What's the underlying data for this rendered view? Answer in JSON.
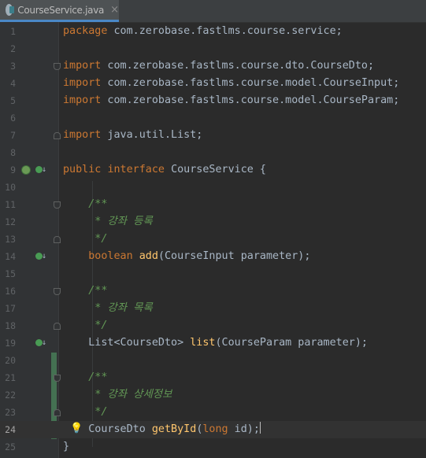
{
  "tab": {
    "label": "CourseService.java",
    "close": "×",
    "icon": "interface-file-icon"
  },
  "lines": [
    {
      "n": "1"
    },
    {
      "n": "2"
    },
    {
      "n": "3"
    },
    {
      "n": "4"
    },
    {
      "n": "5"
    },
    {
      "n": "6"
    },
    {
      "n": "7"
    },
    {
      "n": "8"
    },
    {
      "n": "9"
    },
    {
      "n": "10"
    },
    {
      "n": "11"
    },
    {
      "n": "12"
    },
    {
      "n": "13"
    },
    {
      "n": "14"
    },
    {
      "n": "15"
    },
    {
      "n": "16"
    },
    {
      "n": "17"
    },
    {
      "n": "18"
    },
    {
      "n": "19"
    },
    {
      "n": "20"
    },
    {
      "n": "21"
    },
    {
      "n": "22"
    },
    {
      "n": "23"
    },
    {
      "n": "24"
    },
    {
      "n": "25"
    }
  ],
  "code": {
    "l1_kw": "package",
    "l1_rest": " com.zerobase.fastlms.course.service;",
    "l3_kw": "import",
    "l3_rest": " com.zerobase.fastlms.course.dto.CourseDto;",
    "l4_kw": "import",
    "l4_rest": " com.zerobase.fastlms.course.model.CourseInput;",
    "l5_kw": "import",
    "l5_rest": " com.zerobase.fastlms.course.model.CourseParam;",
    "l7_kw": "import",
    "l7_rest": " java.util.List;",
    "l9_kw1": "public",
    "l9_kw2": "interface",
    "l9_name": "CourseService",
    "l9_rest": " {",
    "l11": "    /**",
    "l12": "     * 강좌 등록",
    "l13": "     */",
    "l14_kw": "boolean",
    "l14_fn": "add",
    "l14_rest": "(CourseInput parameter);",
    "l16": "    /**",
    "l17": "     * 강좌 목록",
    "l18": "     */",
    "l19_type": "List<CourseDto>",
    "l19_fn": "list",
    "l19_rest": "(CourseParam parameter);",
    "l21": "    /**",
    "l22": "     * 강좌 상세정보",
    "l23": "     */",
    "l24_type": "CourseDto",
    "l24_fn": "getById",
    "l24_kw": "long",
    "l24_rest": " id);",
    "l25": "}"
  },
  "colors": {
    "background": "#2b2b2b",
    "gutter": "#313335",
    "keyword": "#cc7832",
    "method": "#ffc66d",
    "text": "#a9b7c6",
    "comment": "#629755",
    "vcs_added": "#447152"
  }
}
